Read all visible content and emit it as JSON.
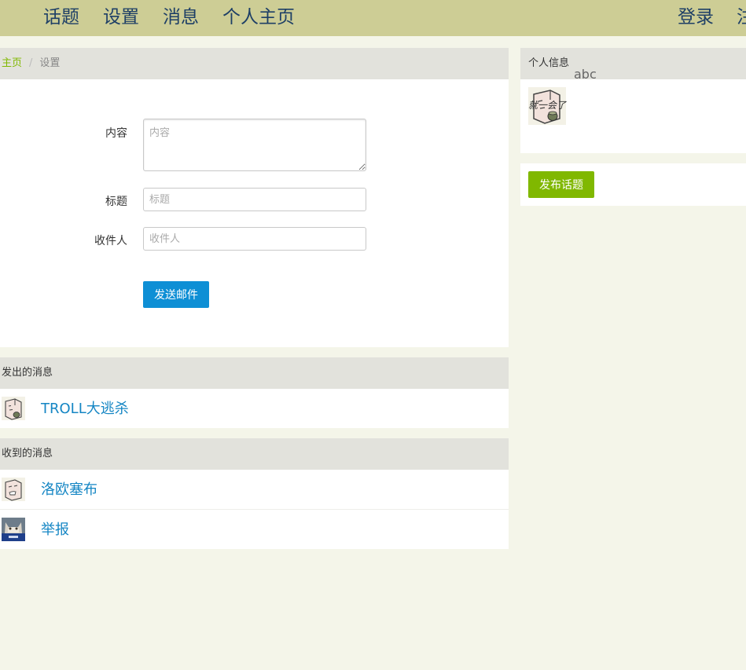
{
  "navbar": {
    "topics": "话题",
    "settings": "设置",
    "messages": "消息",
    "profile": "个人主页",
    "login": "登录",
    "register_partial": "注"
  },
  "breadcrumb": {
    "home": "主页",
    "separator": "/",
    "current": "设置"
  },
  "form": {
    "content_label": "内容",
    "content_placeholder": "内容",
    "title_label": "标题",
    "title_placeholder": "标题",
    "recipient_label": "收件人",
    "recipient_placeholder": "收件人",
    "send_button": "发送邮件"
  },
  "sent": {
    "header": "发出的消息",
    "items": [
      {
        "title": "TROLL大逃杀",
        "avatar": "cartoon-avatar-icon"
      }
    ]
  },
  "received": {
    "header": "收到的消息",
    "items": [
      {
        "title": "洛欧塞布",
        "avatar": "cartoon-avatar-icon"
      },
      {
        "title": "举报",
        "avatar": "cat-photo-avatar"
      }
    ]
  },
  "profile_panel": {
    "header": "个人信息",
    "username": "abc",
    "signature": "就一会了",
    "avatar": "cartoon-avatar-icon"
  },
  "actions": {
    "new_topic_button": "发布话题"
  },
  "colors": {
    "navbar_bg": "#cdcd95",
    "nav_text": "#1e3f66",
    "page_bg": "#f4f5e9",
    "panel_head_bg": "#e2e2dc",
    "link_blue": "#1586c4",
    "primary_button": "#0e8fd5",
    "green_accent": "#80b800"
  }
}
